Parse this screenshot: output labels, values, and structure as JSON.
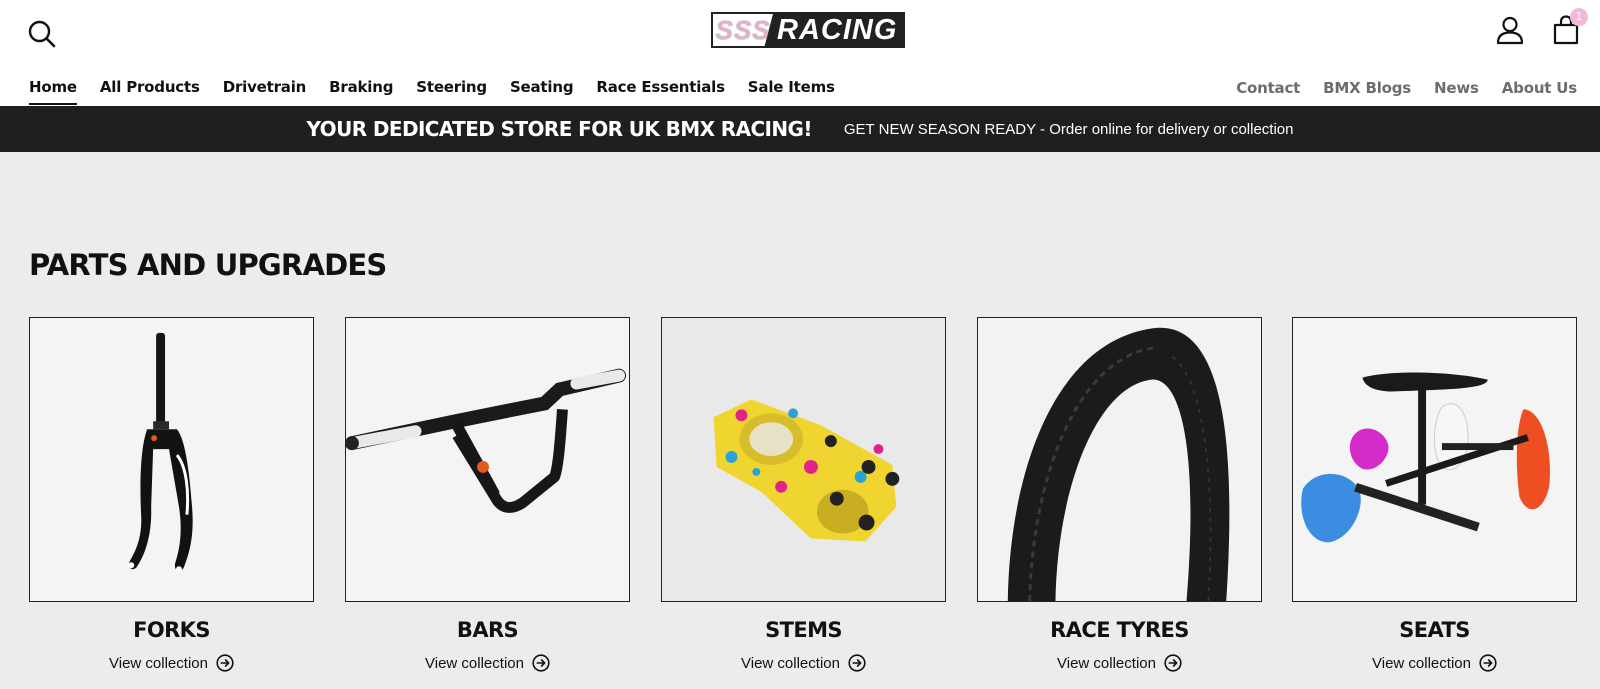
{
  "header": {
    "logo": {
      "mark": "SSS",
      "word": "RACING"
    },
    "cart_count": "1",
    "icons": {
      "search": "search-icon",
      "account": "user-icon",
      "cart": "shopping-bag-icon"
    }
  },
  "nav": {
    "main": [
      "Home",
      "All Products",
      "Drivetrain",
      "Braking",
      "Steering",
      "Seating",
      "Race Essentials",
      "Sale Items"
    ],
    "active": "Home",
    "secondary": [
      "Contact",
      "BMX Blogs",
      "News",
      "About Us"
    ]
  },
  "announcement": {
    "title": "YOUR DEDICATED STORE FOR UK BMX RACING!",
    "text": "GET NEW SEASON READY - Order online for delivery or collection"
  },
  "section": {
    "title": "PARTS AND UPGRADES",
    "link_label": "View collection",
    "collections": [
      {
        "title": "FORKS",
        "link": "View collection"
      },
      {
        "title": "BARS",
        "link": "View collection"
      },
      {
        "title": "STEMS",
        "link": "View collection"
      },
      {
        "title": "RACE TYRES",
        "link": "View collection"
      },
      {
        "title": "SEATS",
        "link": "View collection"
      }
    ]
  },
  "colors": {
    "accent_pink": "#f0a8cf",
    "announce_bg": "#1f1f1f",
    "section_bg": "#ececec"
  }
}
